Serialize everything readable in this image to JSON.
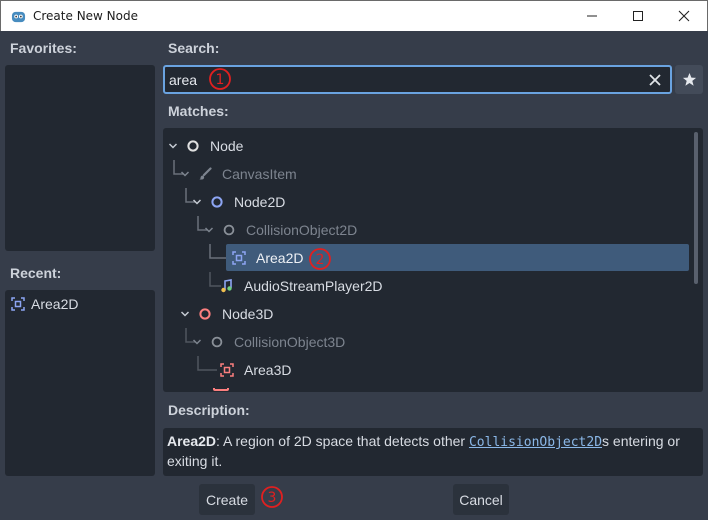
{
  "window": {
    "title": "Create New Node"
  },
  "favorites": {
    "label": "Favorites:"
  },
  "recent": {
    "label": "Recent:",
    "items": [
      {
        "label": "Area2D",
        "icon": "area2d-icon"
      }
    ]
  },
  "search": {
    "label": "Search:",
    "value": "area"
  },
  "matches": {
    "label": "Matches:",
    "tree": [
      {
        "label": "Node",
        "icon": "node-circle-icon"
      },
      {
        "label": "CanvasItem",
        "icon": "brush-icon"
      },
      {
        "label": "Node2D",
        "icon": "node2d-circle-icon"
      },
      {
        "label": "CollisionObject2D",
        "icon": "collision-circle-icon"
      },
      {
        "label": "Area2D",
        "icon": "area2d-icon"
      },
      {
        "label": "AudioStreamPlayer2D",
        "icon": "audio-note-icon"
      },
      {
        "label": "Node3D",
        "icon": "node3d-circle-icon"
      },
      {
        "label": "CollisionObject3D",
        "icon": "collision-circle-icon"
      },
      {
        "label": "Area3D",
        "icon": "area3d-icon"
      }
    ]
  },
  "description": {
    "label": "Description:",
    "name": "Area2D",
    "text_before": ": A region of 2D space that detects other ",
    "link": "CollisionObject2D",
    "text_after": "s entering or exiting it."
  },
  "buttons": {
    "create": "Create",
    "cancel": "Cancel"
  },
  "markers": [
    "①",
    "②",
    "③"
  ],
  "colors": {
    "accent_blue": "#6aa3e0",
    "selection": "#3f5b7b",
    "marker_red": "#e02020",
    "node3d_red": "#fc7f7f",
    "node2d_blue": "#8da5f3"
  }
}
